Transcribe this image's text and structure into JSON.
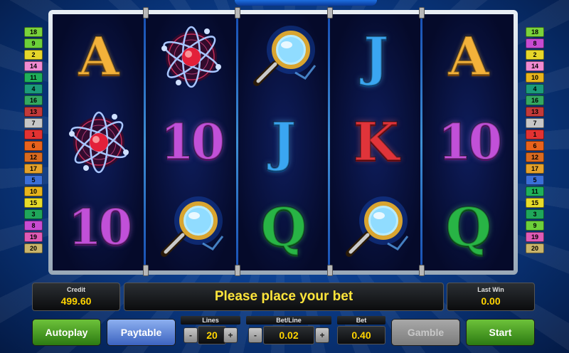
{
  "left_lines": [
    {
      "n": "18",
      "c": "#7ad23b"
    },
    {
      "n": "9",
      "c": "#6ccf3a"
    },
    {
      "n": "2",
      "c": "#e6d62a"
    },
    {
      "n": "14",
      "c": "#f08ad2"
    },
    {
      "n": "11",
      "c": "#1fb05a"
    },
    {
      "n": "4",
      "c": "#1b9a7a"
    },
    {
      "n": "16",
      "c": "#34a861"
    },
    {
      "n": "13",
      "c": "#c23a3a"
    },
    {
      "n": "7",
      "c": "#c7c7c7"
    },
    {
      "n": "1",
      "c": "#e23232"
    },
    {
      "n": "6",
      "c": "#e8621c"
    },
    {
      "n": "12",
      "c": "#d86a20"
    },
    {
      "n": "17",
      "c": "#e3a12b"
    },
    {
      "n": "5",
      "c": "#3a6fd8"
    },
    {
      "n": "10",
      "c": "#e7b41c"
    },
    {
      "n": "15",
      "c": "#e7dc2a"
    },
    {
      "n": "3",
      "c": "#1fa65a"
    },
    {
      "n": "8",
      "c": "#c74bd2"
    },
    {
      "n": "19",
      "c": "#e05ab5"
    },
    {
      "n": "20",
      "c": "#c9b46a"
    }
  ],
  "right_lines": [
    {
      "n": "18",
      "c": "#7ad23b"
    },
    {
      "n": "8",
      "c": "#c74bd2"
    },
    {
      "n": "2",
      "c": "#e6d62a"
    },
    {
      "n": "14",
      "c": "#f08ad2"
    },
    {
      "n": "10",
      "c": "#e7b41c"
    },
    {
      "n": "4",
      "c": "#1b9a7a"
    },
    {
      "n": "16",
      "c": "#34a861"
    },
    {
      "n": "13",
      "c": "#c23a3a"
    },
    {
      "n": "7",
      "c": "#c7c7c7"
    },
    {
      "n": "1",
      "c": "#e23232"
    },
    {
      "n": "6",
      "c": "#e8621c"
    },
    {
      "n": "12",
      "c": "#d86a20"
    },
    {
      "n": "17",
      "c": "#e3a12b"
    },
    {
      "n": "5",
      "c": "#3a6fd8"
    },
    {
      "n": "11",
      "c": "#1fb05a"
    },
    {
      "n": "15",
      "c": "#e7dc2a"
    },
    {
      "n": "3",
      "c": "#1fa65a"
    },
    {
      "n": "9",
      "c": "#6ccf3a"
    },
    {
      "n": "19",
      "c": "#e05ab5"
    },
    {
      "n": "20",
      "c": "#c9b46a"
    }
  ],
  "reels": [
    [
      "A",
      "atom",
      "10"
    ],
    [
      "atom",
      "10",
      "magnifier"
    ],
    [
      "magnifier",
      "J",
      "Q"
    ],
    [
      "J",
      "K",
      "magnifier"
    ],
    [
      "A",
      "10",
      "Q"
    ]
  ],
  "credit": {
    "label": "Credit",
    "value": "499.60"
  },
  "message": "Please place your bet",
  "last_win": {
    "label": "Last Win",
    "value": "0.00"
  },
  "controls": {
    "autoplay": "Autoplay",
    "paytable": "Paytable",
    "lines_label": "Lines",
    "lines_value": "20",
    "betline_label": "Bet/Line",
    "betline_value": "0.02",
    "bet_label": "Bet",
    "bet_value": "0.40",
    "gamble": "Gamble",
    "start": "Start",
    "minus": "-",
    "plus": "+"
  }
}
